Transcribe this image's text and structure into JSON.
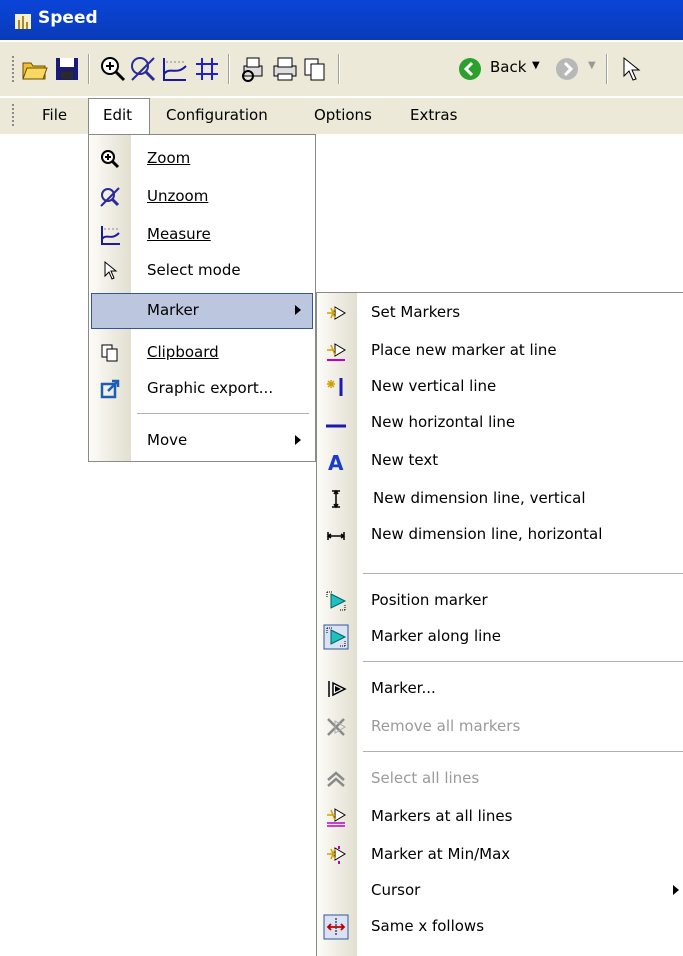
{
  "window": {
    "title": "Speed"
  },
  "toolbar": {
    "back_label": "Back"
  },
  "menubar": {
    "items": [
      "File",
      "Edit",
      "Configuration",
      "Options",
      "Extras"
    ]
  },
  "edit_menu": {
    "items": [
      {
        "label": "Zoom",
        "icon": "zoom-in-icon"
      },
      {
        "label": "Unzoom",
        "icon": "unzoom-icon"
      },
      {
        "label": "Measure",
        "icon": "measure-icon"
      },
      {
        "label": "Select mode",
        "icon": "cursor-arrow-icon"
      },
      {
        "label": "Marker",
        "icon": "",
        "submenu": true,
        "selected": true
      },
      {
        "label": "Clipboard",
        "icon": "clipboard-icon"
      },
      {
        "label": "Graphic export...",
        "icon": "export-icon"
      },
      {
        "label": "Move",
        "icon": "",
        "submenu": true
      }
    ]
  },
  "marker_submenu": {
    "items": [
      {
        "label": "Set Markers",
        "icon": "set-markers-icon",
        "enabled": true
      },
      {
        "label": "Place new marker at line",
        "icon": "place-marker-icon",
        "enabled": true
      },
      {
        "label": "New vertical line",
        "icon": "vertical-line-icon",
        "enabled": true
      },
      {
        "label": "New horizontal line",
        "icon": "horizontal-line-icon",
        "enabled": true
      },
      {
        "label": "New text",
        "icon": "text-icon",
        "enabled": true
      },
      {
        "label": "New dimension line, vertical",
        "icon": "dimension-vertical-icon",
        "enabled": true
      },
      {
        "label": "New dimension line, horizontal",
        "icon": "dimension-horizontal-icon",
        "enabled": true
      },
      {
        "label": "Position marker",
        "icon": "position-marker-icon",
        "enabled": true
      },
      {
        "label": "Marker along line",
        "icon": "marker-along-line-icon",
        "enabled": true,
        "checked": true
      },
      {
        "label": "Marker...",
        "icon": "marker-dialog-icon",
        "enabled": true
      },
      {
        "label": "Remove all markers",
        "icon": "remove-markers-icon",
        "enabled": false
      },
      {
        "label": "Select all lines",
        "icon": "select-lines-icon",
        "enabled": false
      },
      {
        "label": "Markers at all lines",
        "icon": "markers-all-lines-icon",
        "enabled": true
      },
      {
        "label": "Marker at Min/Max",
        "icon": "marker-min-max-icon",
        "enabled": true
      },
      {
        "label": "Cursor",
        "icon": "",
        "enabled": true,
        "submenu": true
      },
      {
        "label": "Same x follows",
        "icon": "same-x-follows-icon",
        "enabled": true,
        "checked": true
      }
    ]
  },
  "colors": {
    "title_bar": "#0a44d8",
    "menu_highlight": "#bcc6df",
    "highlight_border": "#31569c",
    "chrome": "#ece9d8"
  }
}
